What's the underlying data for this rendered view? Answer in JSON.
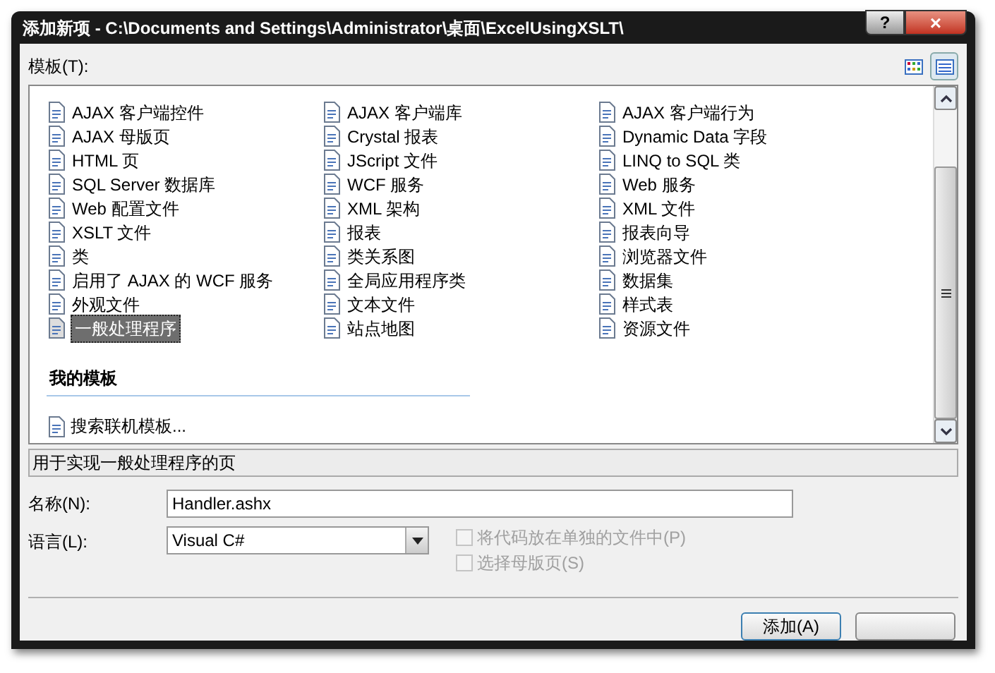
{
  "window": {
    "title": "添加新项 - C:\\Documents and Settings\\Administrator\\桌面\\ExcelUsingXSLT\\",
    "help_button": "?",
    "close_button": "×"
  },
  "view_buttons": [
    {
      "kind": "large-icons",
      "selected": false
    },
    {
      "kind": "small-icons",
      "selected": true
    }
  ],
  "templates_label": "模板(T):",
  "templates": [
    {
      "label": "AJAX 客户端控件",
      "selected": false
    },
    {
      "label": "AJAX 客户端库",
      "selected": false
    },
    {
      "label": "AJAX 客户端行为",
      "selected": false
    },
    {
      "label": "AJAX 母版页",
      "selected": false
    },
    {
      "label": "Crystal 报表",
      "selected": false
    },
    {
      "label": "Dynamic Data 字段",
      "selected": false
    },
    {
      "label": "HTML 页",
      "selected": false
    },
    {
      "label": "JScript 文件",
      "selected": false
    },
    {
      "label": "LINQ to SQL 类",
      "selected": false
    },
    {
      "label": "SQL Server 数据库",
      "selected": false
    },
    {
      "label": "WCF 服务",
      "selected": false
    },
    {
      "label": "Web 服务",
      "selected": false
    },
    {
      "label": "Web 配置文件",
      "selected": false
    },
    {
      "label": "XML 架构",
      "selected": false
    },
    {
      "label": "XML 文件",
      "selected": false
    },
    {
      "label": "XSLT 文件",
      "selected": false
    },
    {
      "label": "报表",
      "selected": false
    },
    {
      "label": "报表向导",
      "selected": false
    },
    {
      "label": "类",
      "selected": false
    },
    {
      "label": "类关系图",
      "selected": false
    },
    {
      "label": "浏览器文件",
      "selected": false
    },
    {
      "label": "启用了 AJAX 的 WCF 服务",
      "selected": false
    },
    {
      "label": "全局应用程序类",
      "selected": false
    },
    {
      "label": "数据集",
      "selected": false
    },
    {
      "label": "外观文件",
      "selected": false
    },
    {
      "label": "文本文件",
      "selected": false
    },
    {
      "label": "样式表",
      "selected": false
    },
    {
      "label": "一般处理程序",
      "selected": true
    },
    {
      "label": "站点地图",
      "selected": false
    },
    {
      "label": "资源文件",
      "selected": false
    }
  ],
  "my_templates": {
    "heading": "我的模板",
    "items": [
      "搜索联机模板..."
    ]
  },
  "description": "用于实现一般处理程序的页",
  "name_field": {
    "label": "名称(N):",
    "value": "Handler.ashx"
  },
  "language_field": {
    "label": "语言(L):",
    "value": "Visual C#"
  },
  "options": [
    {
      "label": "将代码放在单独的文件中(P)",
      "checked": false,
      "disabled": true
    },
    {
      "label": "选择母版页(S)",
      "checked": false,
      "disabled": true
    }
  ],
  "buttons": [
    {
      "label": "添加(A)",
      "kind": "default"
    },
    {
      "kind": "plain"
    }
  ]
}
